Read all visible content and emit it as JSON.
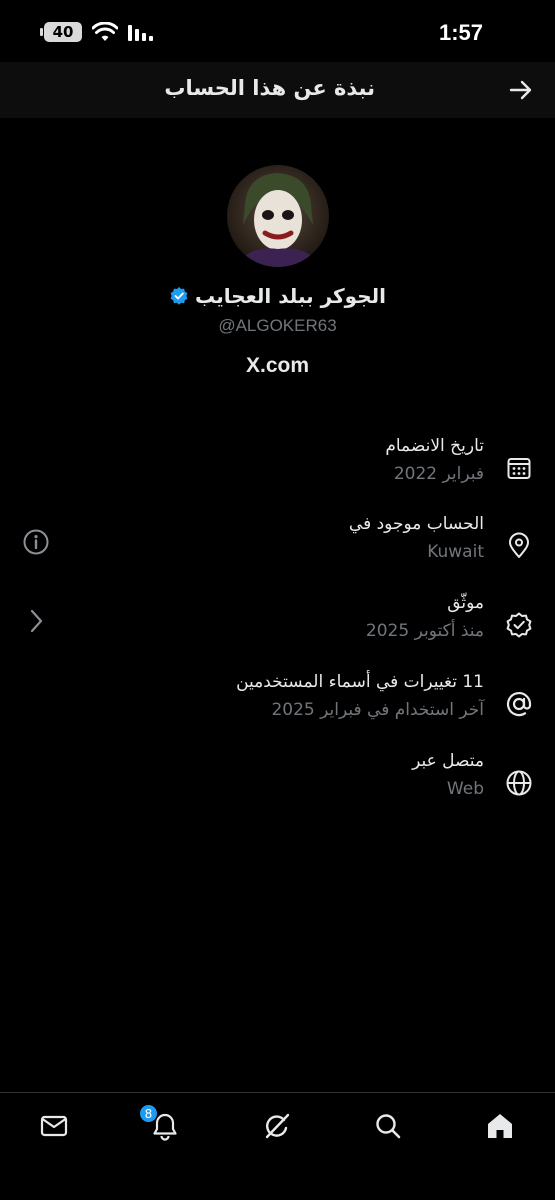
{
  "status_bar": {
    "battery_level": "40",
    "time": "1:57"
  },
  "header": {
    "title": "نبذة عن هذا الحساب"
  },
  "profile": {
    "display_name": "الجوكر ببلد العجايب",
    "handle": "@ALGOKER63",
    "platform": "X.com",
    "verified_color": "#1d9bf0"
  },
  "info": [
    {
      "icon": "calendar-icon",
      "title": "تاريخ الانضمام",
      "subtitle": "فبراير 2022"
    },
    {
      "icon": "location-pin-icon",
      "title": "الحساب موجود في",
      "subtitle": "Kuwait"
    },
    {
      "icon": "verified-badge-icon",
      "title": "موثّق",
      "subtitle": "منذ أكتوبر 2025"
    },
    {
      "icon": "at-sign-icon",
      "title": "11 تغييرات في أسماء المستخدمين",
      "subtitle": "آخر استخدام في فبراير 2025"
    },
    {
      "icon": "globe-icon",
      "title": "متصل عبر",
      "subtitle": "Web"
    }
  ],
  "nav": {
    "notifications_badge": "8",
    "items": [
      "messages-icon",
      "notifications-icon",
      "grok-icon",
      "search-icon",
      "home-icon"
    ]
  }
}
